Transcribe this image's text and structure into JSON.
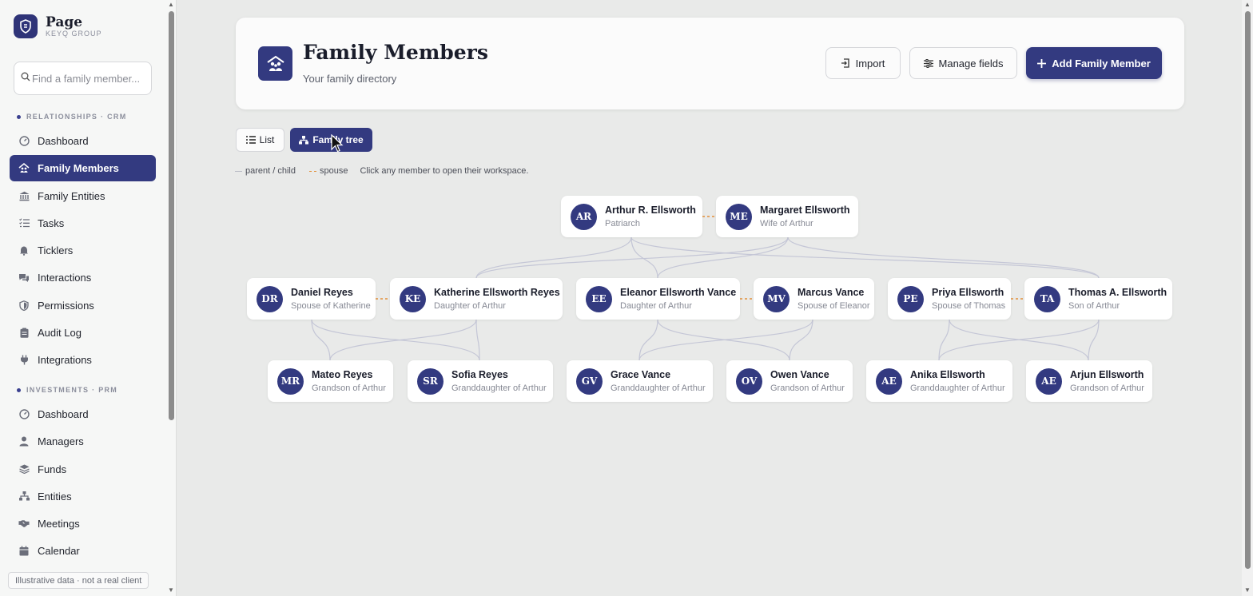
{
  "brand": {
    "name": "Page",
    "subtitle": "KEYQ GROUP"
  },
  "search": {
    "placeholder": "Find a family member..."
  },
  "sections": {
    "relationships": "RELATIONSHIPS · CRM",
    "investments": "INVESTMENTS · PRM"
  },
  "nav_relationships": [
    {
      "label": "Dashboard",
      "icon": "gauge-icon"
    },
    {
      "label": "Family Members",
      "icon": "family-icon",
      "active": true
    },
    {
      "label": "Family Entities",
      "icon": "bank-icon"
    },
    {
      "label": "Tasks",
      "icon": "checklist-icon"
    },
    {
      "label": "Ticklers",
      "icon": "bell-icon"
    },
    {
      "label": "Interactions",
      "icon": "chat-icon"
    },
    {
      "label": "Permissions",
      "icon": "shield-icon"
    },
    {
      "label": "Audit Log",
      "icon": "clipboard-icon"
    },
    {
      "label": "Integrations",
      "icon": "plug-icon"
    }
  ],
  "nav_investments": [
    {
      "label": "Dashboard",
      "icon": "gauge-icon"
    },
    {
      "label": "Managers",
      "icon": "user-icon"
    },
    {
      "label": "Funds",
      "icon": "layers-icon"
    },
    {
      "label": "Entities",
      "icon": "hierarchy-icon"
    },
    {
      "label": "Meetings",
      "icon": "handshake-icon"
    },
    {
      "label": "Calendar",
      "icon": "calendar-icon"
    }
  ],
  "footer_note": "Illustrative data · not a real client",
  "header": {
    "title": "Family Members",
    "subtitle": "Your family directory",
    "import_label": "Import",
    "manage_label": "Manage fields",
    "add_label": "Add Family Member"
  },
  "view": {
    "list_label": "List",
    "tree_label": "Family tree"
  },
  "legend": {
    "parent_child": "parent / child",
    "spouse": "spouse",
    "hint": "Click any member to open their workspace."
  },
  "tree": {
    "generation_1": [
      {
        "initials": "AR",
        "name": "Arthur R. Ellsworth",
        "role": "Patriarch"
      },
      {
        "initials": "ME",
        "name": "Margaret Ellsworth",
        "role": "Wife of Arthur"
      }
    ],
    "generation_2": [
      {
        "initials": "DR",
        "name": "Daniel Reyes",
        "role": "Spouse of Katherine"
      },
      {
        "initials": "KE",
        "name": "Katherine Ellsworth Reyes",
        "role": "Daughter of Arthur"
      },
      {
        "initials": "EE",
        "name": "Eleanor Ellsworth Vance",
        "role": "Daughter of Arthur"
      },
      {
        "initials": "MV",
        "name": "Marcus Vance",
        "role": "Spouse of Eleanor"
      },
      {
        "initials": "PE",
        "name": "Priya Ellsworth",
        "role": "Spouse of Thomas"
      },
      {
        "initials": "TA",
        "name": "Thomas A. Ellsworth",
        "role": "Son of Arthur"
      }
    ],
    "generation_3": [
      {
        "initials": "MR",
        "name": "Mateo Reyes",
        "role": "Grandson of Arthur"
      },
      {
        "initials": "SR",
        "name": "Sofia Reyes",
        "role": "Granddaughter of Arthur"
      },
      {
        "initials": "GV",
        "name": "Grace Vance",
        "role": "Granddaughter of Arthur"
      },
      {
        "initials": "OV",
        "name": "Owen Vance",
        "role": "Grandson of Arthur"
      },
      {
        "initials": "AE",
        "name": "Anika Ellsworth",
        "role": "Granddaughter of Arthur"
      },
      {
        "initials": "AE",
        "name": "Arjun Ellsworth",
        "role": "Grandson of Arthur"
      }
    ]
  },
  "colors": {
    "accent": "#333a80",
    "spouse_line": "#e2903b",
    "parent_line": "#c4c6d6"
  }
}
